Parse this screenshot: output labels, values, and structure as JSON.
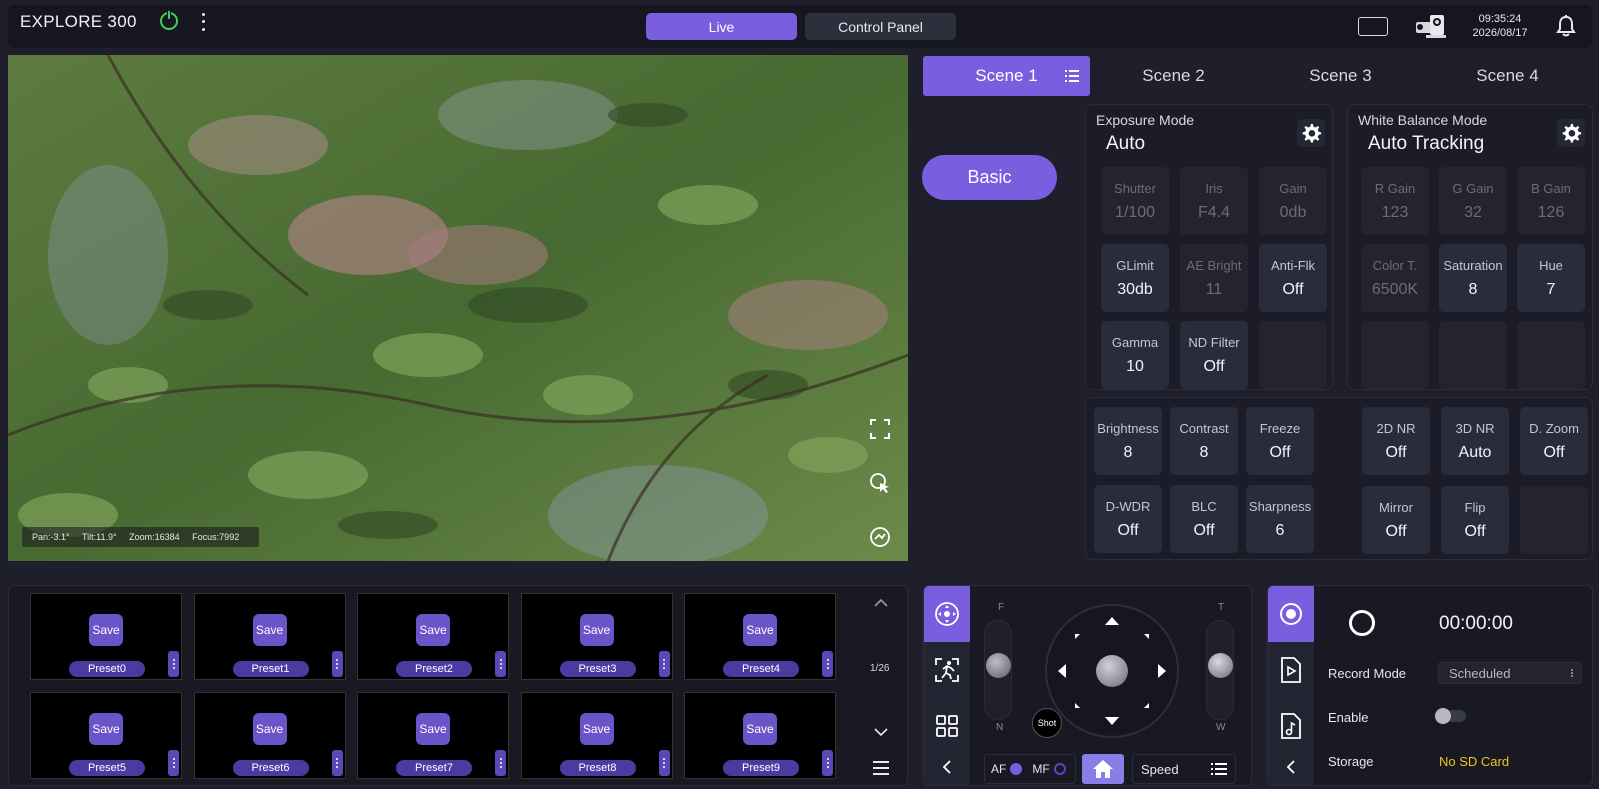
{
  "header": {
    "brand": "EXPLORE 300",
    "tabs": {
      "live": "Live",
      "control_panel": "Control Panel"
    },
    "time": "09:35:24",
    "date": "2026/08/17",
    "accent": "#7a5ee0",
    "status_color": "#3fd05a"
  },
  "video": {
    "osd": {
      "pan": "Pan:-3.1°",
      "tilt": "Tilt:11.9°",
      "zoom": "Zoom:16384",
      "focus": "Focus:7992"
    }
  },
  "scenes": {
    "tabs": [
      "Scene 1",
      "Scene 2",
      "Scene 3",
      "Scene 4"
    ],
    "active": "Scene 1",
    "mode_button": "Basic"
  },
  "exposure": {
    "title": "Exposure Mode",
    "value": "Auto",
    "cells": [
      {
        "label": "Shutter",
        "value": "1/100"
      },
      {
        "label": "Iris",
        "value": "F4.4"
      },
      {
        "label": "Gain",
        "value": "0db"
      },
      {
        "label": "GLimit",
        "value": "30db"
      },
      {
        "label": "AE Bright",
        "value": "11"
      },
      {
        "label": "Anti-Flk",
        "value": "Off"
      },
      {
        "label": "Gamma",
        "value": "10"
      },
      {
        "label": "ND Filter",
        "value": "Off"
      },
      {
        "label": "",
        "value": ""
      }
    ]
  },
  "white_balance": {
    "title": "White Balance Mode",
    "value": "Auto Tracking",
    "cells": [
      {
        "label": "R Gain",
        "value": "123"
      },
      {
        "label": "G Gain",
        "value": "32"
      },
      {
        "label": "B Gain",
        "value": "126"
      },
      {
        "label": "Color T.",
        "value": "6500K"
      },
      {
        "label": "Saturation",
        "value": "8"
      },
      {
        "label": "Hue",
        "value": "7"
      },
      {
        "label": "",
        "value": ""
      },
      {
        "label": "",
        "value": ""
      },
      {
        "label": "",
        "value": ""
      }
    ]
  },
  "image": {
    "left_cells": [
      {
        "label": "Brightness",
        "value": "8"
      },
      {
        "label": "Contrast",
        "value": "8"
      },
      {
        "label": "Freeze",
        "value": "Off"
      },
      {
        "label": "D-WDR",
        "value": "Off"
      },
      {
        "label": "BLC",
        "value": "Off"
      },
      {
        "label": "Sharpness",
        "value": "6"
      }
    ],
    "right_cells": [
      {
        "label": "2D NR",
        "value": "Off"
      },
      {
        "label": "3D NR",
        "value": "Auto"
      },
      {
        "label": "D. Zoom",
        "value": "Off"
      },
      {
        "label": "Mirror",
        "value": "Off"
      },
      {
        "label": "Flip",
        "value": "Off"
      },
      {
        "label": "",
        "value": ""
      }
    ]
  },
  "presets": {
    "save_label": "Save",
    "items": [
      "Preset0",
      "Preset1",
      "Preset2",
      "Preset3",
      "Preset4",
      "Preset5",
      "Preset6",
      "Preset7",
      "Preset8",
      "Preset9"
    ],
    "page": "1/26"
  },
  "ptz": {
    "focus_top": "F",
    "focus_bottom": "N",
    "zoom_top": "T",
    "zoom_bottom": "W",
    "shot_label": "Shot",
    "af_label": "AF",
    "mf_label": "MF",
    "speed_label": "Speed"
  },
  "recording": {
    "timer": "00:00:00",
    "record_mode_label": "Record Mode",
    "record_mode_value": "Scheduled",
    "enable_label": "Enable",
    "storage_label": "Storage",
    "storage_value": "No SD Card",
    "storage_color": "#f0c419"
  }
}
